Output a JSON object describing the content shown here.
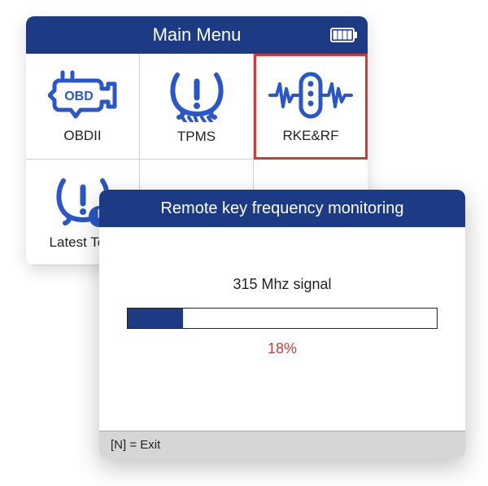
{
  "colors": {
    "brand": "#1c3b84",
    "accent_red": "#d23a3a"
  },
  "main_menu": {
    "title": "Main Menu",
    "battery_level": 4,
    "items": [
      {
        "label": "OBDII",
        "icon": "obd-icon",
        "selected": false
      },
      {
        "label": "TPMS",
        "icon": "tpms-icon",
        "selected": false
      },
      {
        "label": "RKE&RF",
        "icon": "rke-rf-icon",
        "selected": true
      },
      {
        "label": "Latest Test",
        "icon": "latest-test-icon",
        "selected": false
      }
    ]
  },
  "monitoring": {
    "title": "Remote key frequency monitoring",
    "signal_label": "315 Mhz signal",
    "percent": 18,
    "percent_label": "18%",
    "footer_hint": "[N] = Exit"
  }
}
